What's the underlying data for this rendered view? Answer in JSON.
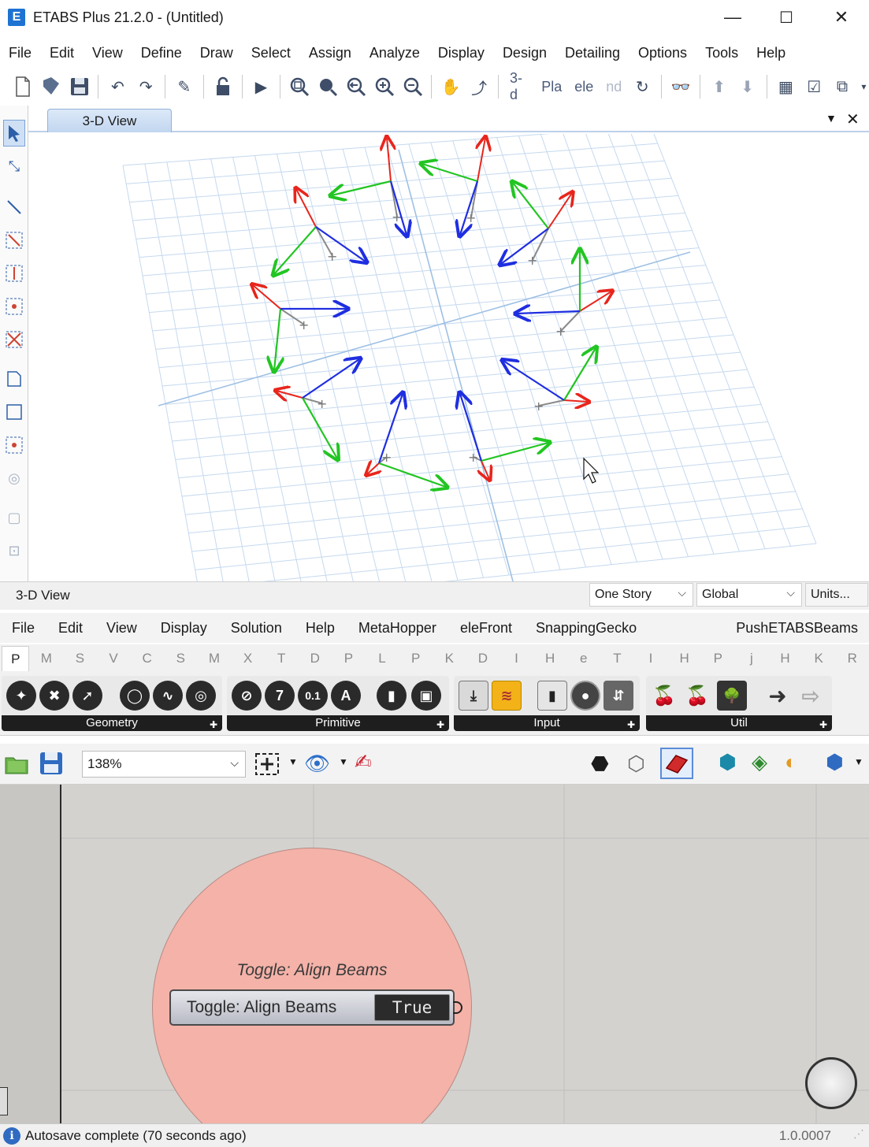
{
  "window": {
    "title": "ETABS Plus 21.2.0 - (Untitled)",
    "logo_letter": "E",
    "minimize": "—",
    "maximize": "☐",
    "close": "✕"
  },
  "etabs_menu": [
    "File",
    "Edit",
    "View",
    "Define",
    "Draw",
    "Select",
    "Assign",
    "Analyze",
    "Display",
    "Design",
    "Detailing",
    "Options",
    "Tools",
    "Help"
  ],
  "etabs_toolbar": {
    "text_3d": "3-d",
    "text_pla": "Pla",
    "text_ele": "ele",
    "text_nd": "nd"
  },
  "view_tab": {
    "label": "3-D View"
  },
  "view_status": {
    "label": "3-D View",
    "story_combo": "One Story",
    "coord_combo": "Global",
    "units_button": "Units..."
  },
  "gh_menu": [
    "File",
    "Edit",
    "View",
    "Display",
    "Solution",
    "Help",
    "MetaHopper",
    "eleFront",
    "SnappingGecko"
  ],
  "gh_menu_right": "PushETABSBeams",
  "gh_tabs": [
    "P",
    "M",
    "S",
    "V",
    "C",
    "S",
    "M",
    "X",
    "T",
    "D",
    "P",
    "L",
    "P",
    "K",
    "D",
    "I",
    "H",
    "e",
    "T",
    "I",
    "H",
    "P",
    "j",
    "H",
    "K",
    "R"
  ],
  "gh_ribbon": {
    "groups": [
      "Geometry",
      "Primitive",
      "Input",
      "Util"
    ],
    "primitive_icons": [
      "7",
      "0.1",
      "A"
    ]
  },
  "gh_toolbar": {
    "zoom": "138%"
  },
  "gh_canvas": {
    "group_title": "Toggle: Align Beams",
    "toggle_label": "Toggle: Align Beams",
    "toggle_value": "True",
    "group_color": "#f4b2a8"
  },
  "gh_status": {
    "message": "Autosave complete (70 seconds ago)",
    "version": "1.0.0007"
  }
}
